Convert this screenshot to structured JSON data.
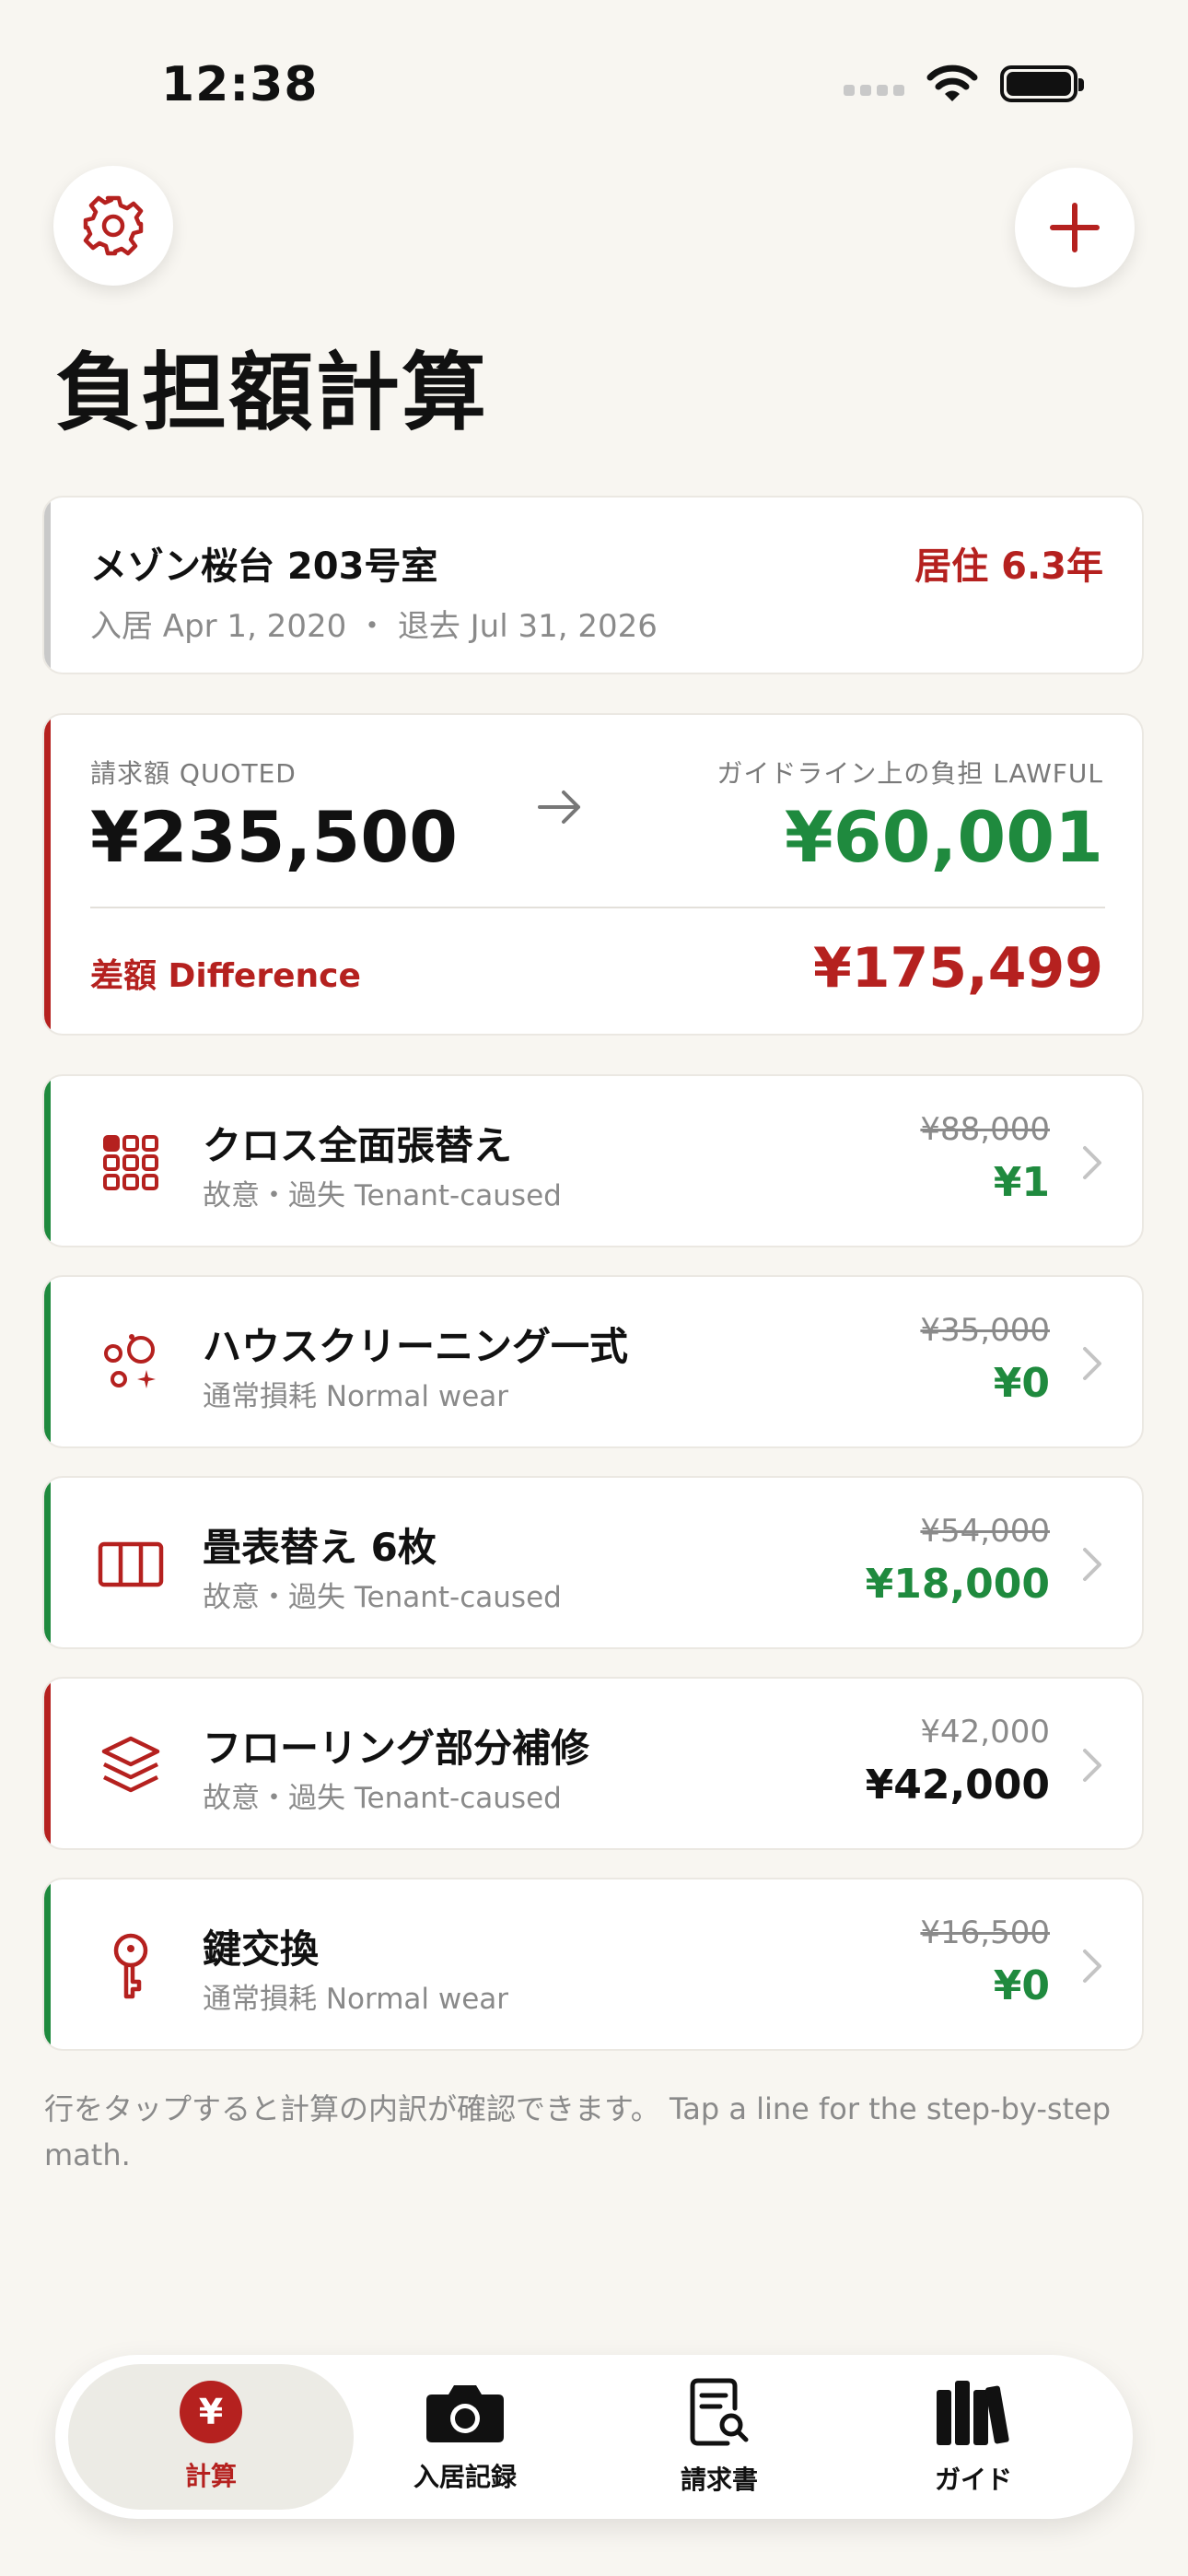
{
  "status": {
    "time": "12:38"
  },
  "header": {
    "title": "負担額計算"
  },
  "property": {
    "name": "メゾン桜台 203号室",
    "tenure": "居住 6.3年",
    "dates": "入居 Apr 1, 2020 ・ 退去 Jul 31, 2026"
  },
  "summary": {
    "quoted_label": "請求額 QUOTED",
    "quoted_amount": "¥235,500",
    "lawful_label": "ガイドライン上の負担 LAWFUL",
    "lawful_amount": "¥60,001",
    "difference_label": "差額 Difference",
    "difference_amount": "¥175,499"
  },
  "items": [
    {
      "icon": "grid-icon",
      "title": "クロス全面張替え",
      "category": "故意・過失 Tenant-caused",
      "quoted": "¥88,000",
      "lawful": "¥1",
      "accent": "#1f8a3e"
    },
    {
      "icon": "sparkle-bubbles-icon",
      "title": "ハウスクリーニング一式",
      "category": "通常損耗 Normal wear",
      "quoted": "¥35,000",
      "lawful": "¥0",
      "accent": "#1f8a3e"
    },
    {
      "icon": "tatami-icon",
      "title": "畳表替え 6枚",
      "category": "故意・過失 Tenant-caused",
      "quoted": "¥54,000",
      "lawful": "¥18,000",
      "accent": "#1f8a3e"
    },
    {
      "icon": "layers-icon",
      "title": "フローリング部分補修",
      "category": "故意・過失 Tenant-caused",
      "quoted": "¥42,000",
      "lawful": "¥42,000",
      "accent": "#b5211f"
    },
    {
      "icon": "key-icon",
      "title": "鍵交換",
      "category": "通常損耗 Normal wear",
      "quoted": "¥16,500",
      "lawful": "¥0",
      "accent": "#1f8a3e"
    }
  ],
  "footnote": "行をタップすると計算の内訳が確認できます。 Tap a line for the step-by-step math.",
  "tabs": [
    {
      "label": "計算",
      "icon": "yen-icon",
      "active": true
    },
    {
      "label": "入居記録",
      "icon": "camera-icon"
    },
    {
      "label": "請求書",
      "icon": "document-search-icon"
    },
    {
      "label": "ガイド",
      "icon": "books-icon"
    }
  ],
  "colors": {
    "accent_red": "#b5211f",
    "green": "#1f8a3e",
    "background": "#f8f6f1"
  }
}
